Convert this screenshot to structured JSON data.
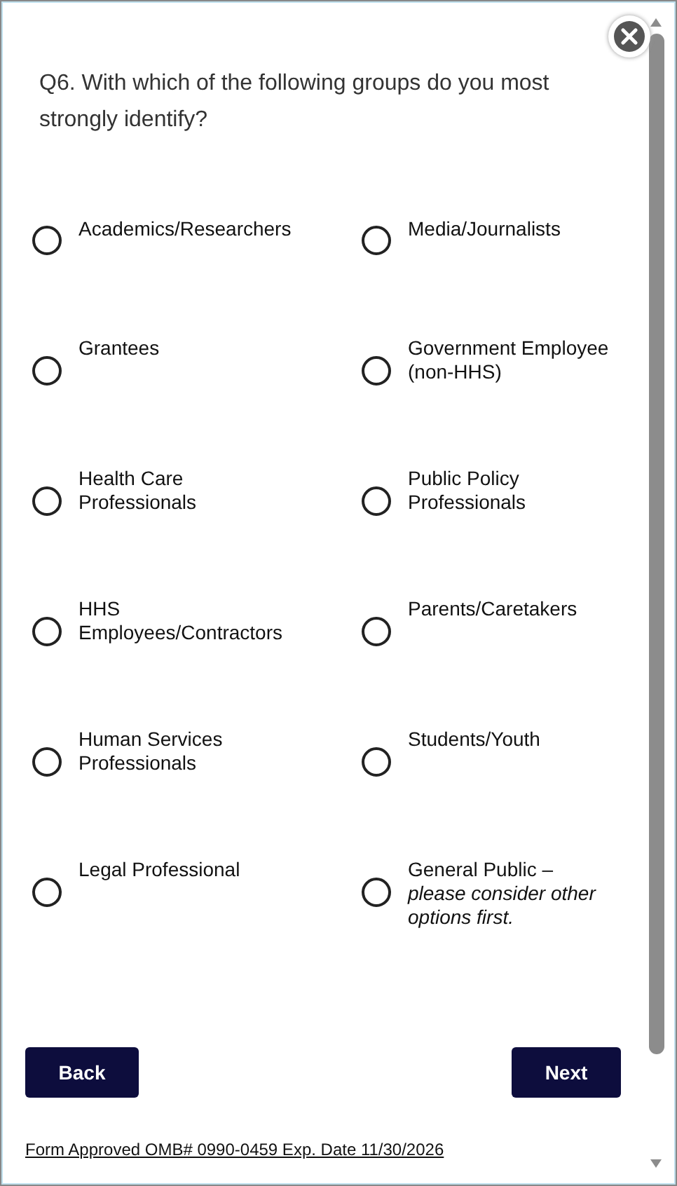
{
  "question": "Q6. With which of the following groups do you most strongly identify?",
  "options": [
    {
      "label": "Academics/Researchers",
      "selected": false
    },
    {
      "label": "Media/Journalists",
      "selected": false
    },
    {
      "label": "Grantees",
      "selected": false
    },
    {
      "label": "Government Employee (non-HHS)",
      "selected": false
    },
    {
      "label": "Health Care Professionals",
      "selected": false
    },
    {
      "label": "Public Policy Professionals",
      "selected": false
    },
    {
      "label": "HHS Employees/Contractors",
      "selected": false
    },
    {
      "label": "Parents/Caretakers",
      "selected": false
    },
    {
      "label": "Human Services Professionals",
      "selected": false
    },
    {
      "label": "Students/Youth",
      "selected": false
    },
    {
      "label": "Legal Professional",
      "selected": false
    },
    {
      "label": "General Public –",
      "note": "please consider other options first.",
      "selected": false
    }
  ],
  "buttons": {
    "back": "Back",
    "next": "Next"
  },
  "footer": "Form Approved OMB# 0990-0459 Exp. Date 11/30/2026"
}
